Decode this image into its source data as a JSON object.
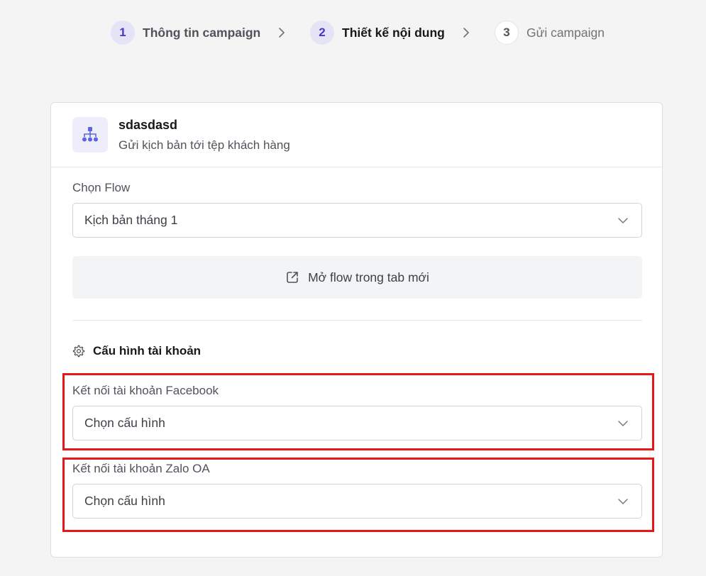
{
  "stepper": {
    "steps": [
      {
        "number": "1",
        "label": "Thông tin campaign"
      },
      {
        "number": "2",
        "label": "Thiết kế nội dung"
      },
      {
        "number": "3",
        "label": "Gửi campaign"
      }
    ]
  },
  "card": {
    "icon": "flow-hierarchy-icon",
    "title": "sdasdasd",
    "subtitle": "Gửi kịch bản tới tệp khách hàng"
  },
  "flow": {
    "label": "Chọn Flow",
    "selected": "Kịch bản tháng 1",
    "open_button": "Mở flow trong tab mới"
  },
  "account_config": {
    "icon": "gear-icon",
    "title": "Cấu hình tài khoản",
    "facebook": {
      "label": "Kết nối tài khoản Facebook",
      "placeholder": "Chọn cấu hình"
    },
    "zalo": {
      "label": "Kết nối tài khoản Zalo OA",
      "placeholder": "Chọn cấu hình"
    }
  },
  "colors": {
    "accent": "#4338ca",
    "highlight": "#e81717",
    "background": "#f4f4f5"
  }
}
